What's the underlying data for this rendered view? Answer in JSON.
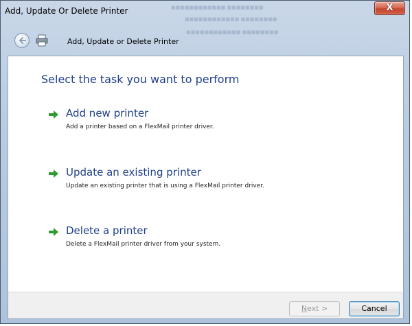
{
  "window": {
    "title": "Add, Update Or Delete Printer",
    "close_label": "X"
  },
  "navbar": {
    "title": "Add,  Update or Delete Printer"
  },
  "main": {
    "heading": "Select the task you want to perform",
    "options": [
      {
        "title": "Add new printer",
        "description": "Add a printer based on a FlexMail printer driver."
      },
      {
        "title": "Update an existing printer",
        "description": "Update an existing printer that is using a FlexMail printer driver."
      },
      {
        "title": "Delete a printer",
        "description": "Delete a FlexMail printer driver from your system."
      }
    ]
  },
  "footer": {
    "next_key": "N",
    "next_rest": "ext >",
    "cancel_label": "Cancel"
  },
  "colors": {
    "heading": "#1e3f8a",
    "arrow": "#2e9b2e",
    "frame": "#b9cbe0"
  },
  "icons": {
    "back": "back-arrow-icon",
    "wizard": "printer-wizard-icon",
    "option": "green-arrow-icon",
    "close": "close-icon"
  }
}
